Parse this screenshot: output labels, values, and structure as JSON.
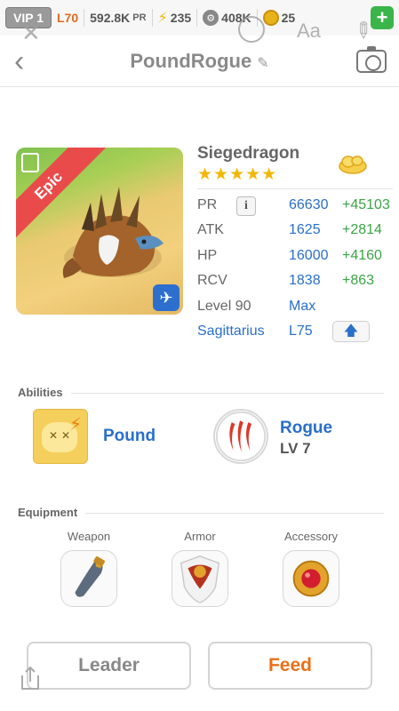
{
  "topbar": {
    "vip": "VIP 1",
    "level": "L70",
    "pr_value": "592.8K",
    "pr_unit": "PR",
    "energy": "235",
    "gears": "408K",
    "coins": "25",
    "add": "+"
  },
  "overlay": {
    "aa": "Aa"
  },
  "header": {
    "back": "‹",
    "title": "PoundRogue",
    "edit": "✎"
  },
  "hero": {
    "rarity": "Epic",
    "name": "Siegedragon",
    "stars": "★★★★★",
    "star_count": 5,
    "stats": {
      "pr_label": "PR",
      "pr_info": "i",
      "pr_value": "66630",
      "pr_bonus": "+45103",
      "atk_label": "ATK",
      "atk_value": "1625",
      "atk_bonus": "+2814",
      "hp_label": "HP",
      "hp_value": "16000",
      "hp_bonus": "+4160",
      "rcv_label": "RCV",
      "rcv_value": "1838",
      "rcv_bonus": "+863",
      "level_label": "Level 90",
      "level_value": "Max",
      "sign_label": "Sagittarius",
      "sign_value": "L75",
      "upgrade": "🡅"
    }
  },
  "abilities": {
    "section": "Abilities",
    "first_name": "Pound",
    "second_name": "Rogue",
    "second_level": "LV 7"
  },
  "equipment": {
    "section": "Equipment",
    "weapon": "Weapon",
    "armor": "Armor",
    "accessory": "Accessory"
  },
  "actions": {
    "leader": "Leader",
    "feed": "Feed"
  },
  "colors": {
    "accent_blue": "#2a6fc9",
    "bonus_green": "#3aa544",
    "feed_orange": "#ea7019",
    "epic_red": "#e94b4b"
  }
}
